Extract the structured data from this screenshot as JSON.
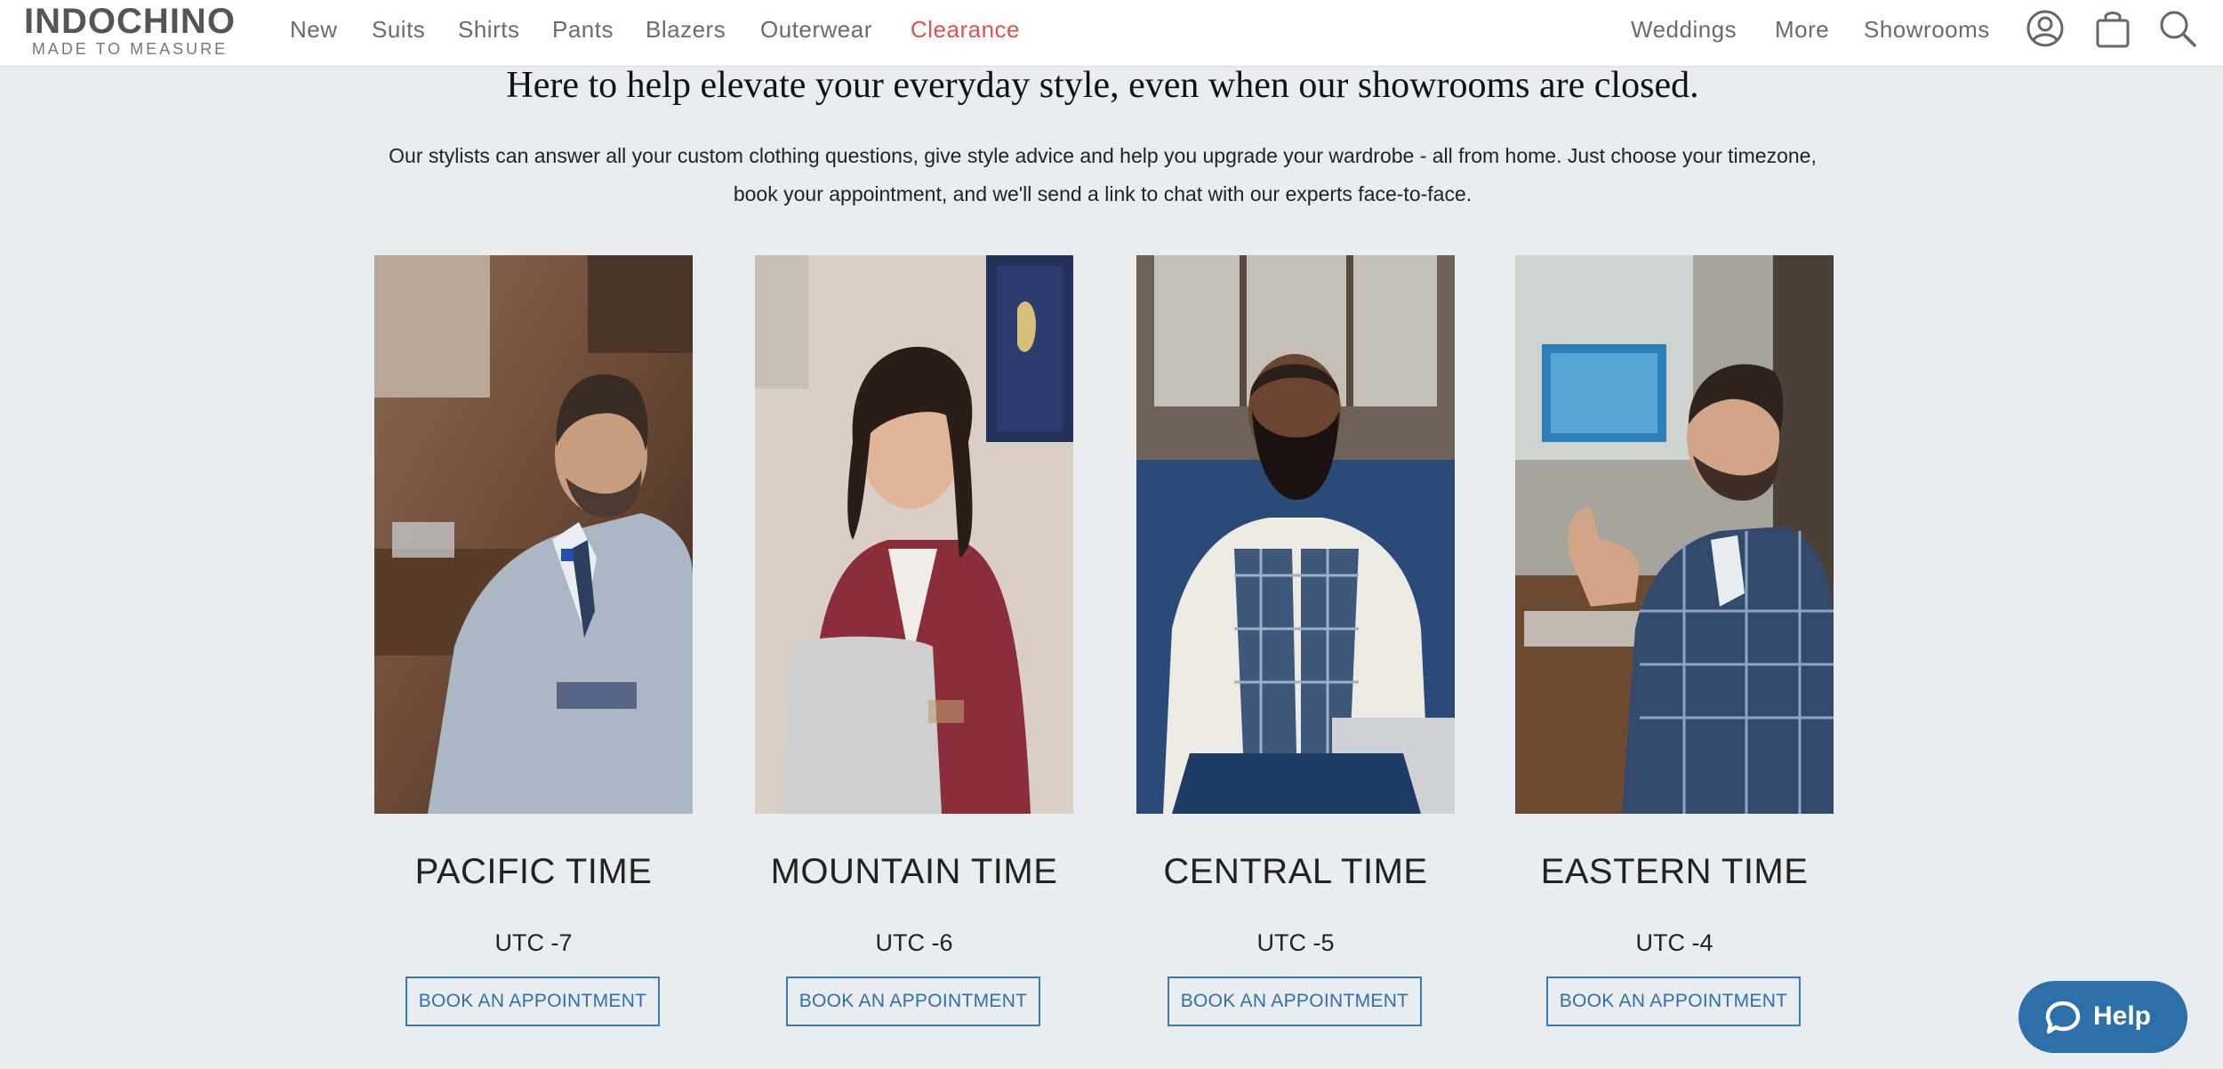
{
  "header": {
    "logo": {
      "name": "INDOCHINO",
      "tagline": "MADE TO MEASURE"
    },
    "nav_left": [
      "New",
      "Suits",
      "Shirts",
      "Pants",
      "Blazers",
      "Outerwear",
      "Clearance"
    ],
    "nav_right": [
      "Weddings",
      "More",
      "Showrooms"
    ],
    "icons": [
      "account-icon",
      "shopping-bag-icon",
      "search-icon"
    ],
    "clearance_color": "#d9534f"
  },
  "hero": {
    "headline": "Here to help elevate your everyday style, even when our showrooms are closed.",
    "intro": "Our stylists can answer all your custom clothing questions, give style advice and help you upgrade your wardrobe - all from home. Just choose your timezone, book your appointment, and we'll send a link to chat with our experts face-to-face."
  },
  "cards": [
    {
      "timezone": "PACIFIC TIME",
      "utc": "UTC -7",
      "button": "BOOK AN APPOINTMENT",
      "photo": "stylist in light grey suit working at laptop"
    },
    {
      "timezone": "MOUNTAIN TIME",
      "utc": "UTC -6",
      "button": "BOOK AN APPOINTMENT",
      "photo": "stylist in burgundy blazer smiling at laptop"
    },
    {
      "timezone": "CENTRAL TIME",
      "utc": "UTC -5",
      "button": "BOOK AN APPOINTMENT",
      "photo": "stylist in plaid vest with measuring tape"
    },
    {
      "timezone": "EASTERN TIME",
      "utc": "UTC -4",
      "button": "BOOK AN APPOINTMENT",
      "photo": "stylist in blue check blazer giving thumbs up"
    }
  ],
  "help": {
    "label": "Help"
  },
  "colors": {
    "background": "#e9edf0",
    "accent_blue": "#2f6fad",
    "help_blue": "#2d6fa8"
  }
}
